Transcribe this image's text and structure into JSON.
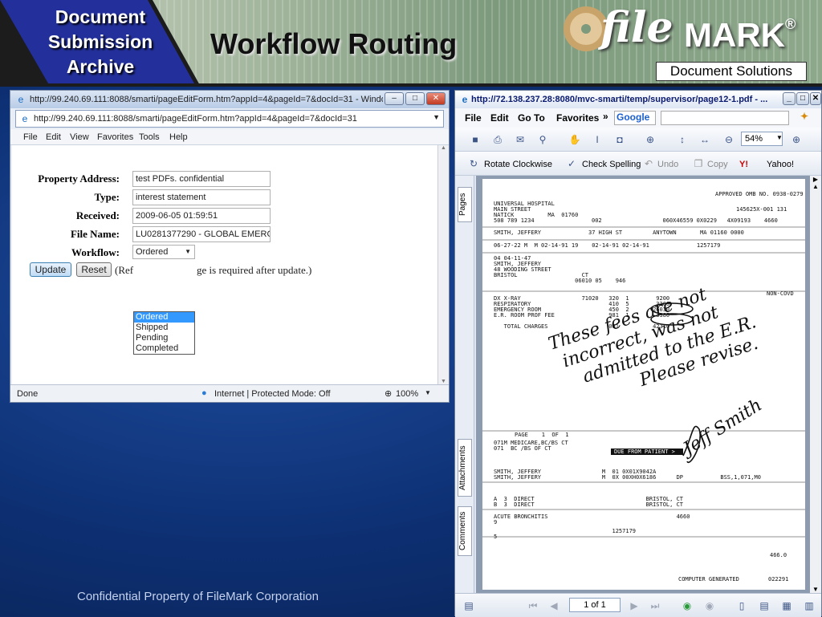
{
  "header": {
    "badge_lines": [
      "Document",
      "Submission",
      "Archive"
    ],
    "title": "Workflow Routing",
    "logo_file": "file",
    "logo_mark": "MARK",
    "logo_reg": "®",
    "tagline": "Document Solutions"
  },
  "ie": {
    "title": "http://99.240.69.111:8088/smarti/pageEditForm.htm?appId=4&pageId=7&docId=31 - Windows I...",
    "address": "http://99.240.69.111:8088/smarti/pageEditForm.htm?appId=4&pageId=7&docId=31",
    "menu": [
      "File",
      "Edit",
      "View",
      "Favorites",
      "Tools",
      "Help"
    ],
    "form": {
      "labels": [
        "Property Address:",
        "Type:",
        "Received:",
        "File Name:",
        "Workflow:"
      ],
      "values": [
        "test PDFs. confidential",
        "interest statement",
        "2009-06-05 01:59:51",
        "LU0281377290 - GLOBAL EMERG"
      ],
      "workflow_selected": "Ordered",
      "workflow_options": [
        "Ordered",
        "Shipped",
        "Pending",
        "Completed"
      ],
      "update_label": "Update",
      "reset_label": "Reset",
      "note_prefix": "(Ref",
      "note_suffix": "ge is required after update.)"
    },
    "status_done": "Done",
    "status_zone": "Internet | Protected Mode: Off",
    "zoom": "100%"
  },
  "pdf": {
    "title": "http://72.138.237.28:8080/mvc-smarti/temp/supervisor/page12-1.pdf - ...",
    "menu": [
      "File",
      "Edit",
      "Go To",
      "Favorites"
    ],
    "google_label": "Google",
    "zoom_value": "54%",
    "rotate_label": "Rotate Clockwise",
    "spell_label": "Check Spelling",
    "undo_label": "Undo",
    "copy_label": "Copy",
    "yahoo_label": "Yahoo!",
    "side_tabs": [
      "Pages",
      "Attachments",
      "Comments"
    ],
    "page_display": "1 of 1",
    "document": {
      "approved": "APPROVED OMB NO. 0938-0279",
      "provider": [
        "UNIVERSAL HOSPITAL",
        "MAIN STREET",
        "NATICK          MA  01760",
        "508 789 1234"
      ],
      "control_no": "145625X-001 131",
      "ids": "002                  060X46559 0X0229   4X09193    4660",
      "patient_line": "SMITH, JEFFERY              37 HIGH ST         ANYTOWN       MA 01160 0000",
      "dates_line": "06-27-22 M  M 02-14-91 19    02-14-91 02-14-91              1257179",
      "more": [
        "04 04-11-47",
        "SMITH, JEFFERY",
        "48 WOODING STREET",
        "BRISTOL                   CT",
        "                        06010 05    946"
      ],
      "charges": [
        "DX X-RAY                  71020   320  1        9200",
        "RESPIRATORY                       410  5        3200",
        "EMERGENCY ROOM                    450  2       26030",
        "E.R. ROOM PROF FEE                981  1        3380",
        "",
        "   TOTAL CHARGES                  001          42310"
      ],
      "non_covd": "NON-COVD",
      "page_line": "PAGE    1  OF  1",
      "payers": [
        "071M MEDICARE,BC/BS CT",
        "071  BC /BS OF CT"
      ],
      "due": "DUE FROM PATIENT >",
      "insured": [
        "SMITH, JEFFERY                  M  01 0X01X9042A",
        "SMITH, JEFFERY                  M  0X 00XH0X6186      DP           BSS,1,071,M0"
      ],
      "employer": [
        "A  3  DIRECT                                 BRISTOL, CT",
        "B  3  DIRECT                                 BRISTOL, CT"
      ],
      "diagnosis": [
        "ACUTE BRONCHITIS                                      4660",
        "9"
      ],
      "codes": [
        "                                   1257179",
        "5"
      ],
      "total_right": "466.0",
      "computer": "COMPUTER GENERATED",
      "number_right": "022291",
      "handwriting": [
        "These fees are not",
        "incorrect, was not",
        "admitted to the E.R.",
        "Please revise.",
        "Jeff Smith"
      ]
    }
  },
  "footer": "Confidential Property of FileMark Corporation"
}
